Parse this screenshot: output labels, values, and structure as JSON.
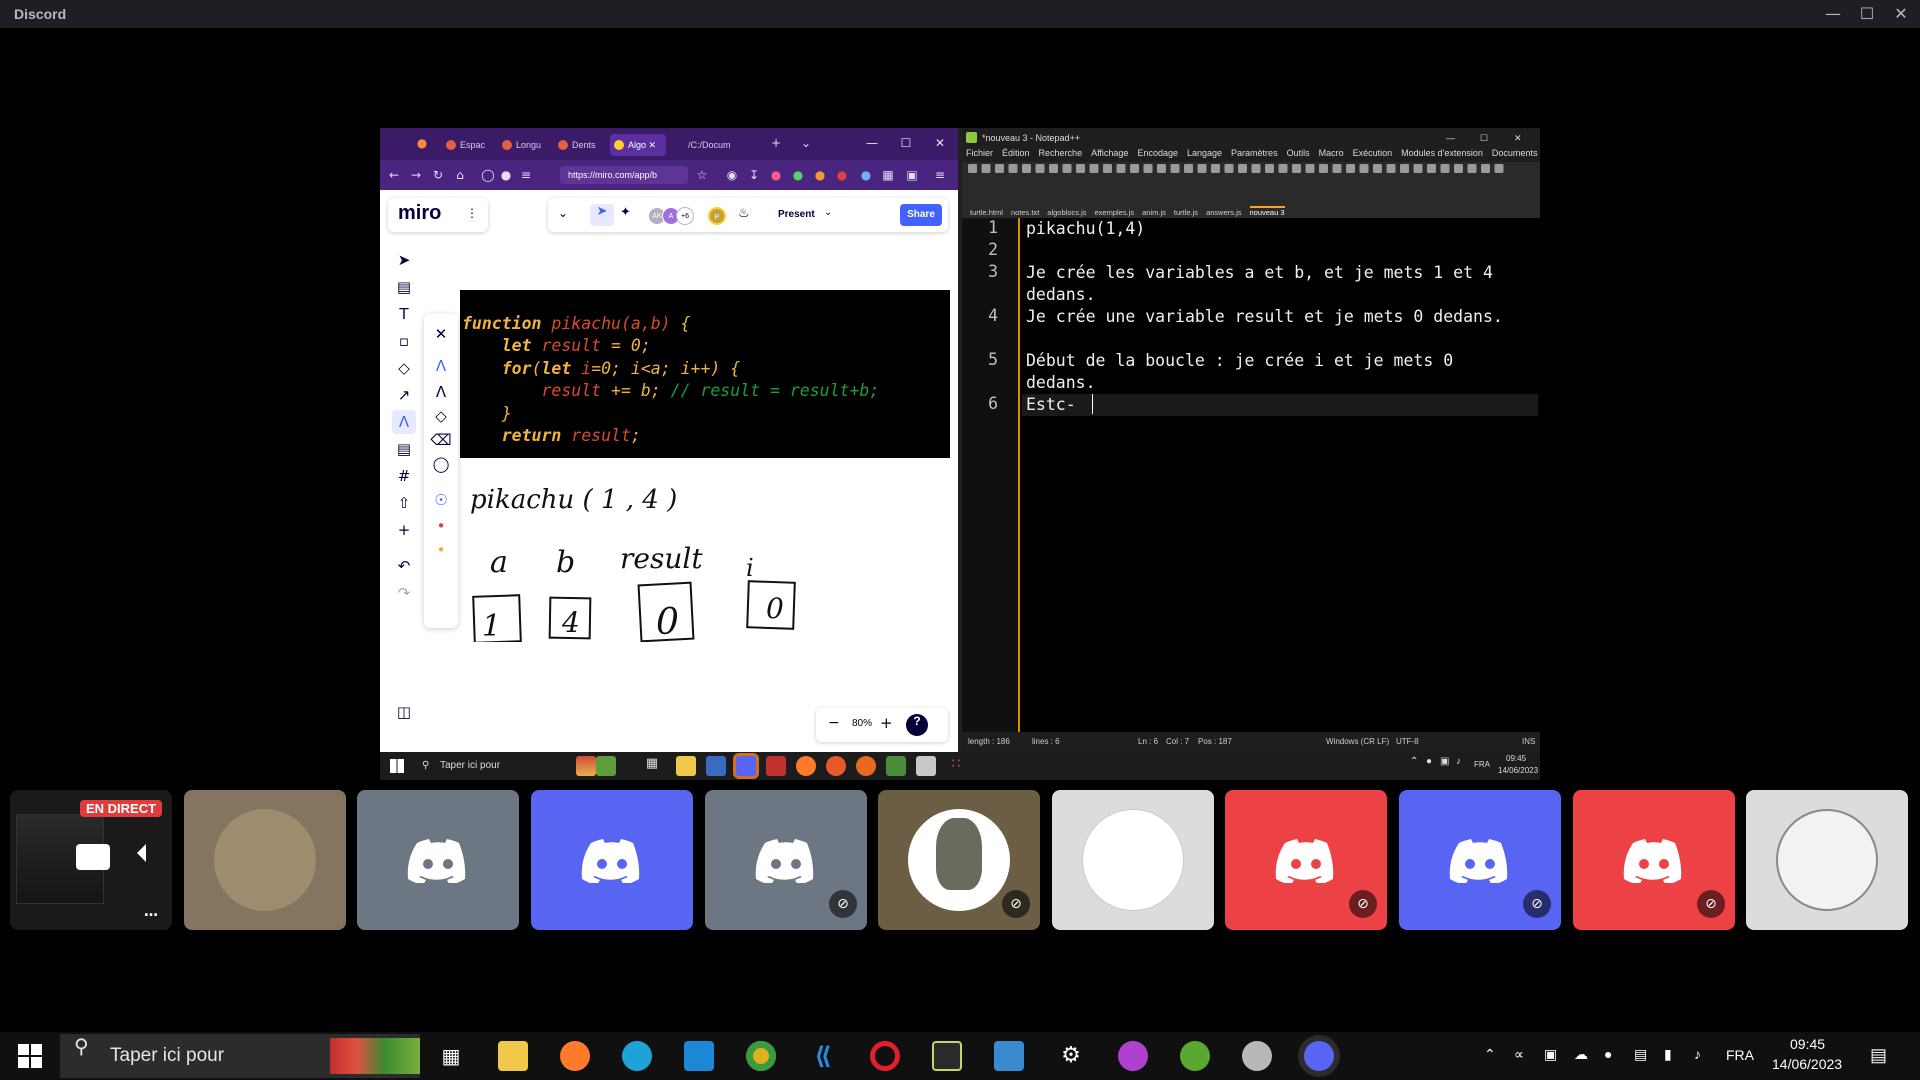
{
  "app": {
    "title": "Discord"
  },
  "screen_share": {
    "browser": {
      "tabs": [
        "Espac",
        "Longu",
        "Dents",
        "Algo",
        "/C:/Docum"
      ],
      "active_tab_index": 3,
      "url": "https://miro.com/app/b",
      "miro": {
        "logo": "miro",
        "present_label": "Present",
        "share_label": "Share",
        "extra_avatars": "+6",
        "avatar_initials": [
          "AK",
          "A",
          "P"
        ],
        "zoom": "80%",
        "code_lines": [
          {
            "kw": "function ",
            "fn": "pikachu(a,b)",
            "rest": " {"
          },
          {
            "pre": "    ",
            "kw": "let ",
            "fn": "result",
            "rest": " = 0;"
          },
          {
            "pre": "    ",
            "kw": "for",
            "rest": "(",
            "kw2": "let ",
            "fn": "i",
            "rest2": "=0; i<a; i++) {"
          },
          {
            "pre": "        ",
            "fn": "result",
            "rest": " += b; ",
            "cm": "// result = result+b;"
          },
          {
            "pre": "    ",
            "rest": "}"
          },
          {
            "pre": "    ",
            "kw": "return ",
            "fn": "result",
            "rest": ";"
          }
        ],
        "handwriting": [
          "pikachu ( 1 , 4 )",
          "a",
          "b",
          "result",
          "i",
          "1",
          "4",
          "0",
          "0"
        ]
      }
    },
    "notepad": {
      "title": "*nouveau 3 - Notepad++",
      "menu": [
        "Fichier",
        "Édition",
        "Recherche",
        "Affichage",
        "Encodage",
        "Langage",
        "Paramètres",
        "Outils",
        "Macro",
        "Exécution",
        "Modules d'extension",
        "Documents"
      ],
      "tabs": [
        "turtle.html",
        "notes.txt",
        "algoblocs.js",
        "exemples.js",
        "anim.js",
        "turtle.js",
        "answers.js",
        "nouveau 3"
      ],
      "active_tab_index": 7,
      "lines": [
        {
          "n": "1",
          "text": "pikachu(1,4)"
        },
        {
          "n": "2",
          "text": ""
        },
        {
          "n": "3",
          "text": "Je crée les variables a et b, et je mets 1 et 4 dedans."
        },
        {
          "n": "4",
          "text": "Je crée une variable result et je mets 0 dedans."
        },
        {
          "n": "5",
          "text": "Début de la boucle : je crée i et je mets 0 dedans."
        },
        {
          "n": "6",
          "text": "Estc-"
        }
      ],
      "status": {
        "length": "length : 186",
        "lines": "lines : 6",
        "ln": "Ln : 6",
        "col": "Col : 7",
        "pos": "Pos : 187",
        "eol": "Windows (CR LF)",
        "encoding": "UTF-8",
        "mode": "INS"
      }
    },
    "inner_taskbar": {
      "search": "Taper ici pour",
      "lang": "FRA",
      "time": "09:45",
      "date": "14/06/2023"
    }
  },
  "participants": {
    "live_label": "EN DIRECT",
    "colors": {
      "grey": "#6d7683",
      "blurple": "#5865f2",
      "red": "#ed4245"
    }
  },
  "taskbar": {
    "search_placeholder": "Taper ici pour",
    "lang": "FRA",
    "time": "09:45",
    "date": "14/06/2023"
  }
}
